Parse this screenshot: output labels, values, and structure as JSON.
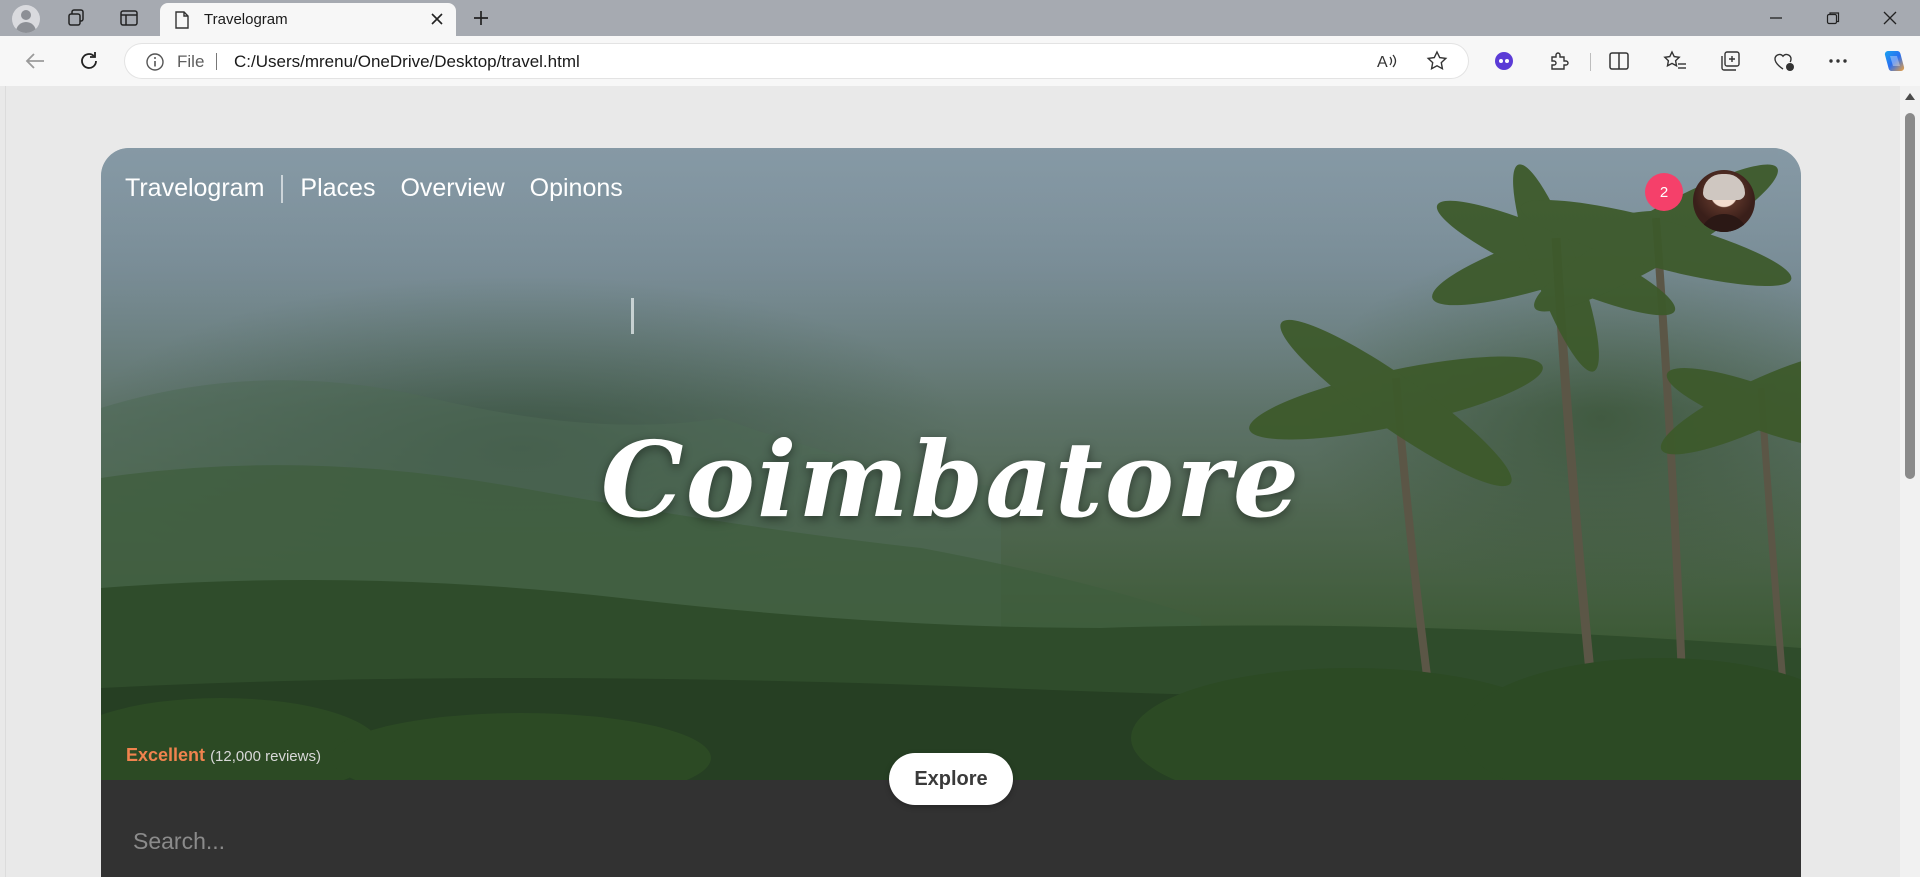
{
  "browser": {
    "tab_title": "Travelogram",
    "address": {
      "protocol_label": "File",
      "url": "C:/Users/mrenu/OneDrive/Desktop/travel.html"
    }
  },
  "page": {
    "nav": {
      "brand": "Travelogram",
      "links": [
        "Places",
        "Overview",
        "Opinons"
      ]
    },
    "notification_count": "2",
    "hero_title": "Coimbatore",
    "rating": {
      "label": "Excellent",
      "count": "(12,000 reviews)"
    },
    "explore_label": "Explore",
    "search": {
      "placeholder": "Search...",
      "value": ""
    }
  },
  "colors": {
    "notification_badge": "#f5406a",
    "rating_label": "#f0834e",
    "dark_panel": "#323232",
    "titlebar": "#a6aab1",
    "toolbar": "#f7f7f7"
  }
}
